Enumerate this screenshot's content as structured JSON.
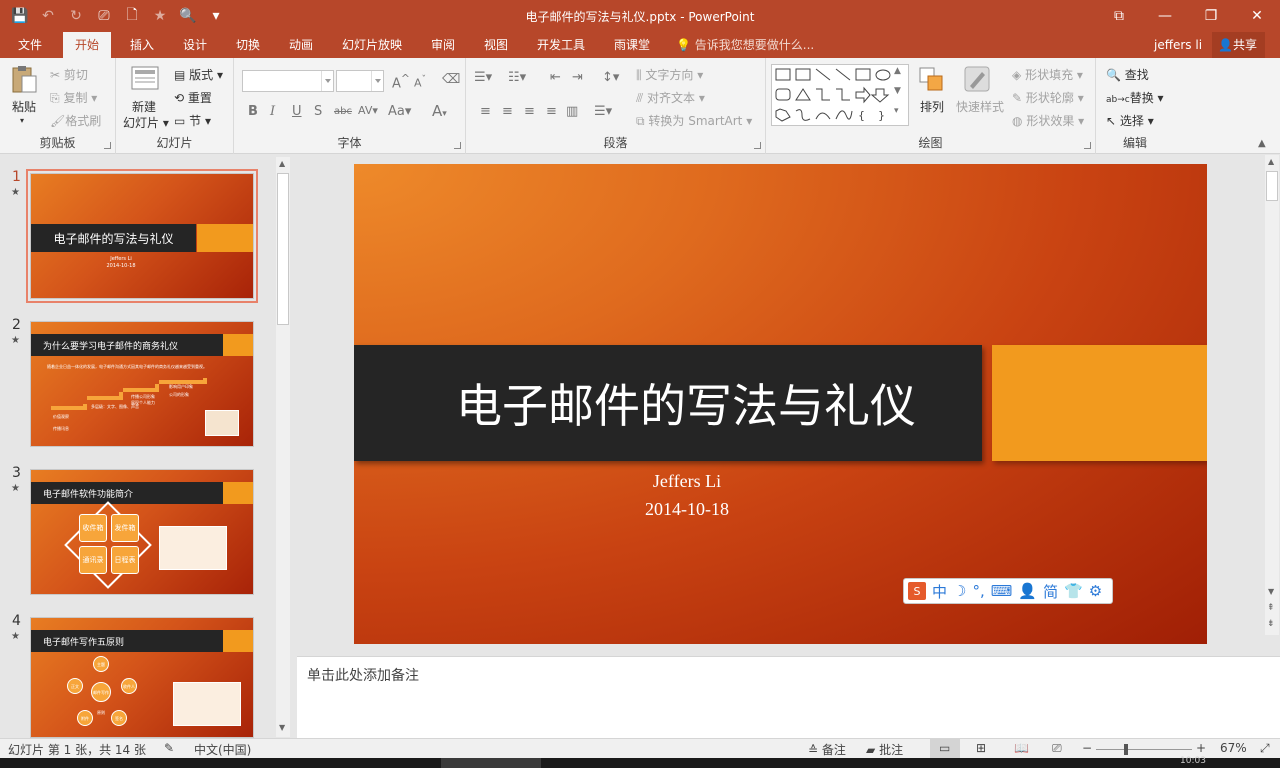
{
  "window": {
    "title": "电子邮件的写法与礼仪.pptx - PowerPoint",
    "controls": {
      "ribbon_display": "⧉",
      "minimize": "—",
      "restore": "❐",
      "close": "✕"
    }
  },
  "qat": {
    "save": "💾",
    "undo": "↶",
    "redo": "↻",
    "present": "⎚",
    "new": "🗋",
    "star": "★",
    "preview": "🔍",
    "more": "▾"
  },
  "tabs": [
    {
      "label": "文件"
    },
    {
      "label": "开始"
    },
    {
      "label": "插入"
    },
    {
      "label": "设计"
    },
    {
      "label": "切换"
    },
    {
      "label": "动画"
    },
    {
      "label": "幻灯片放映"
    },
    {
      "label": "审阅"
    },
    {
      "label": "视图"
    },
    {
      "label": "开发工具"
    },
    {
      "label": "雨课堂"
    }
  ],
  "tellme": "告诉我您想要做什么...",
  "user": "jeffers li",
  "share": "共享",
  "ribbon": {
    "clipboard": {
      "label": "剪贴板",
      "paste": "粘贴",
      "cut": "剪切",
      "copy": "复制",
      "format_painter": "格式刷"
    },
    "slides": {
      "label": "幻灯片",
      "new_slide_1": "新建",
      "new_slide_2": "幻灯片",
      "layout": "版式",
      "reset": "重置",
      "section": "节"
    },
    "font": {
      "label": "字体",
      "bold": "B",
      "italic": "I",
      "underline": "U",
      "shadow": "S",
      "strike": "abc",
      "spacing": "AV",
      "case": "Aa",
      "color": "A",
      "grow": "A",
      "shrink": "A"
    },
    "paragraph": {
      "label": "段落",
      "text_direction": "文字方向",
      "align_text": "对齐文本",
      "smartart": "转换为 SmartArt"
    },
    "drawing": {
      "label": "绘图",
      "arrange": "排列",
      "quick_styles": "快速样式",
      "fill": "形状填充",
      "outline": "形状轮廓",
      "effects": "形状效果"
    },
    "editing": {
      "label": "编辑",
      "find": "查找",
      "replace": "替换",
      "select": "选择"
    }
  },
  "thumbnails": [
    {
      "num": "1",
      "title": "电子邮件的写法与礼仪",
      "sub1": "Jeffers Li",
      "sub2": "2014-10-18"
    },
    {
      "num": "2",
      "title": "为什么要学习电子邮件的商务礼仪",
      "bullet": "随着企业日益一体化的发展，电子邮件沟通方式因其电子邮件的商务礼仪越来越受到重视。",
      "labels": [
        "价值观察",
        "传播讯息",
        "多层级：文字、图像、声音",
        "传播公司形象",
        "展现个人能力",
        "影响用户印象",
        "公司的形象"
      ]
    },
    {
      "num": "3",
      "title": "电子邮件软件功能简介",
      "cells": [
        "收件箱",
        "发件箱",
        "通讯录",
        "日程表"
      ]
    },
    {
      "num": "4",
      "title": "电子邮件写作五原则",
      "nodes": [
        "主题",
        "收件人",
        "正文",
        "附件",
        "签名",
        "邮件写作原则"
      ]
    }
  ],
  "slide": {
    "title": "电子邮件的写法与礼仪",
    "author": "Jeffers Li",
    "date": "2014-10-18"
  },
  "ime": [
    "中",
    "☽",
    "°,",
    "⌨",
    "👤",
    "简",
    "👕",
    "⚙"
  ],
  "notes_placeholder": "单击此处添加备注",
  "status": {
    "slide_info": "幻灯片 第 1 张，共 14 张",
    "language": "中文(中国)",
    "notes": "备注",
    "comments": "批注",
    "zoom": "67%",
    "zoom_value": 0.67
  },
  "taskbar": {
    "clock": "10:03"
  },
  "colors": {
    "accent": "#b7472a",
    "slide_orange": "#f29a1e",
    "slide_bar": "#252525"
  }
}
